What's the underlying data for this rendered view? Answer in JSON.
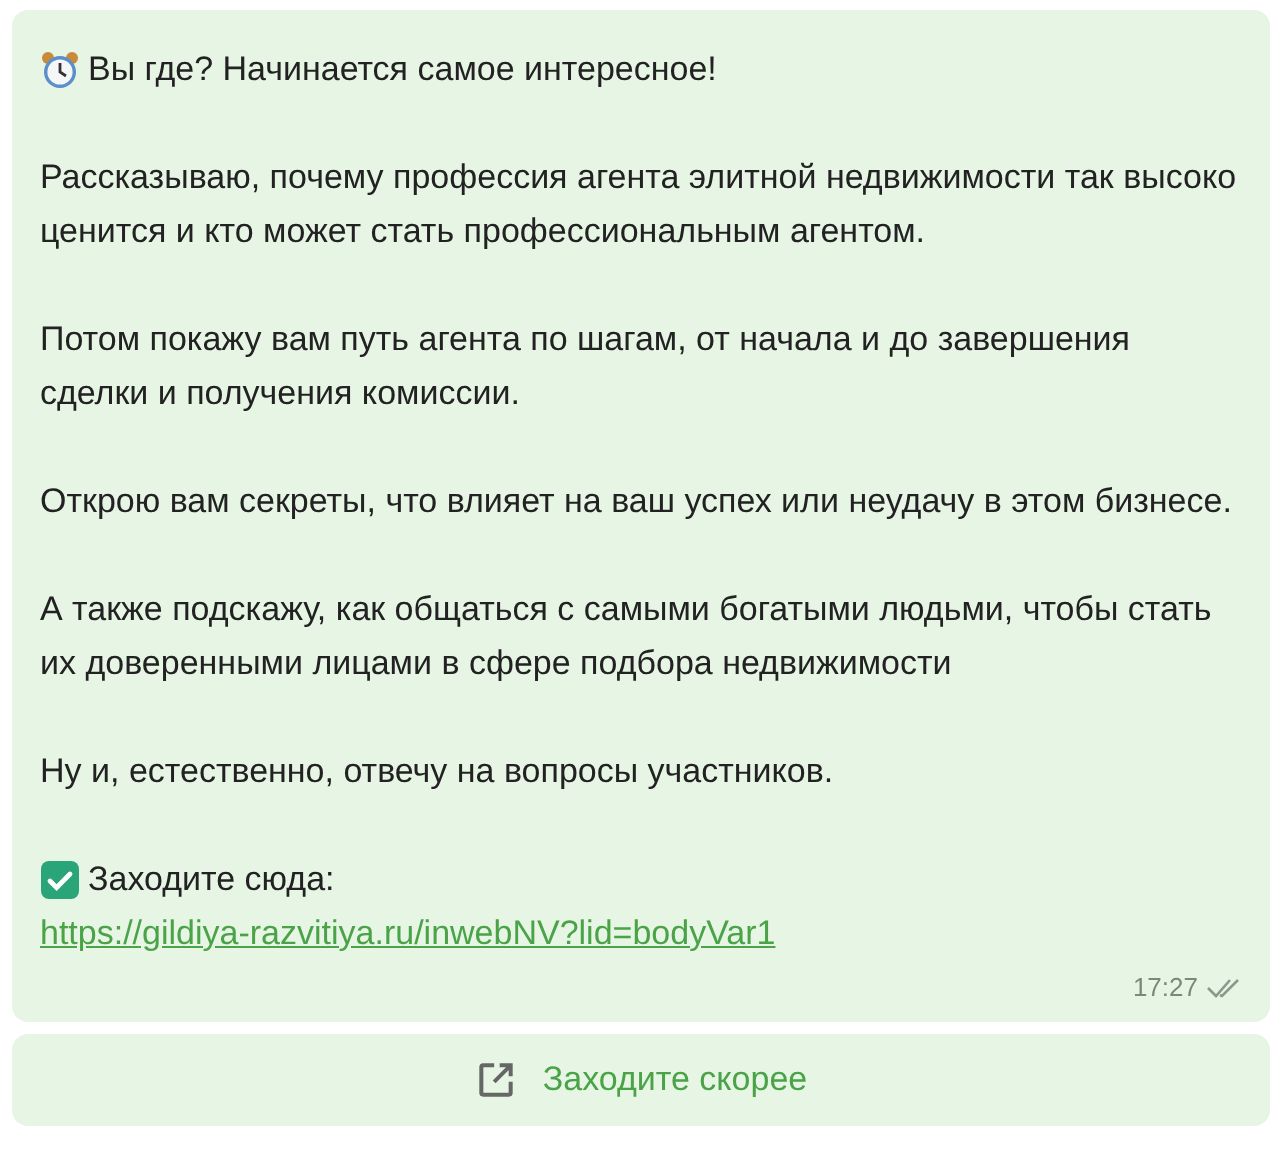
{
  "message": {
    "heading": "Вы где? Начинается самое интересное!",
    "paragraphs": [
      "Рассказываю, почему профессия агента элитной недвижимости так высоко ценится и кто может стать профессиональным агентом.",
      "Потом покажу вам путь агента по шагам, от начала и до завершения сделки и получения комиссии.",
      "Открою вам секреты, что влияет на ваш успех или неудачу в этом бизнесе.",
      "А также подскажу, как общаться с самыми богатыми людьми, чтобы стать их доверенными лицами в сфере подбора недвижимости",
      "Ну и, естественно, отвечу на вопросы участников."
    ],
    "cta_label": "Заходите сюда:",
    "link": "https://gildiya-razvitiya.ru/inwebNV?lid=bodyVar1",
    "time": "17:27",
    "read": true
  },
  "button": {
    "label": "Заходите скорее"
  }
}
